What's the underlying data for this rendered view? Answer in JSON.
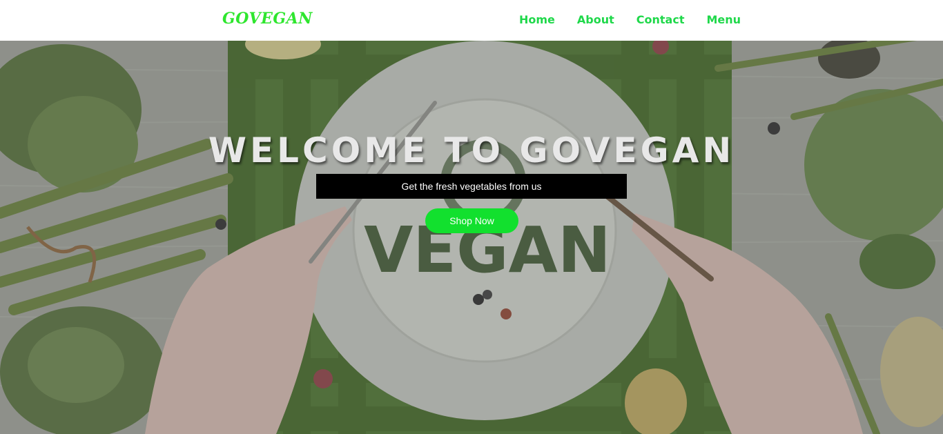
{
  "nav": {
    "logo": "GOVEGAN",
    "links": [
      {
        "label": "Home"
      },
      {
        "label": "About"
      },
      {
        "label": "Contact"
      },
      {
        "label": "Menu"
      }
    ]
  },
  "hero": {
    "title": "WELCOME TO GOVEGAN",
    "tagline": "Get the fresh vegetables from us",
    "cta_label": "Shop Now",
    "plate_text": "VEGAN"
  },
  "colors": {
    "brand_green": "#2ee62e",
    "nav_link_green": "#1fd84a",
    "button_green": "#12e02e",
    "tagline_bg": "#000000",
    "navbar_bg": "#ffffff"
  }
}
